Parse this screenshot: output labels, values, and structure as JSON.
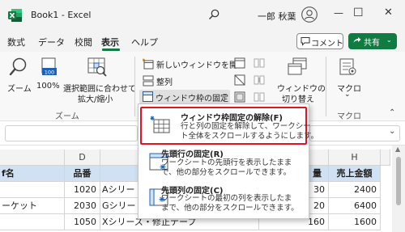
{
  "titlebar": {
    "title": "Book1 - Excel",
    "user": "一郎 秋葉",
    "minimize": "—",
    "maximize": "☐",
    "close": "✕"
  },
  "menu": {
    "tabs": [
      "数式",
      "データ",
      "校閲",
      "表示",
      "ヘルプ"
    ],
    "active": "表示",
    "comment_label": "コメント",
    "share_label": "共有",
    "share_color": "#107c41"
  },
  "ribbon": {
    "zoom_label": "ズーム",
    "zoom100_label": "100%",
    "zoom_selection_line1": "選択範囲に合わせて",
    "zoom_selection_line2": "拡大/縮小",
    "zoom_group_label": "ズーム",
    "new_window_label": "新しいウィンドウを開く",
    "arrange_label": "整列",
    "freeze_panes_label": "ウィンドウ枠の固定",
    "switch_windows_line1": "ウィンドウの",
    "switch_windows_line2": "切り替え",
    "macros_label": "マクロ",
    "macros_group_label": "マクロ"
  },
  "dropdown": {
    "highlight_color": "#e81123",
    "items": [
      {
        "title": "ウィンドウ枠固定の解除(F)",
        "desc1": "行と列の固定を解除して、ワークシー",
        "desc2": "ト全体をスクロールするようにします。"
      },
      {
        "title": "先頭行の固定(R)",
        "desc1": "ワークシートの先頭行を表示したまま",
        "desc2": "で、他の部分をスクロールできます。"
      },
      {
        "title": "先頭列の固定(C)",
        "desc1": "ワークシートの最初の列を表示したま",
        "desc2": "まで、他の部分をスクロールできます。"
      }
    ]
  },
  "grid": {
    "col_d": "D",
    "col_h": "H",
    "header_cells": [
      "f名",
      "品番",
      "量",
      "売上金額"
    ],
    "rows": [
      {
        "c": "",
        "d": "1020",
        "e": "Aシリー",
        "g": "30",
        "h": "2400"
      },
      {
        "c": "ーケット",
        "d": "2030",
        "e": "Gシリー",
        "g": "20",
        "h": "6400"
      },
      {
        "c": "",
        "d": "1050",
        "e": "Xシリーズ・修正テープ",
        "g": "160",
        "h": "1600"
      }
    ]
  }
}
